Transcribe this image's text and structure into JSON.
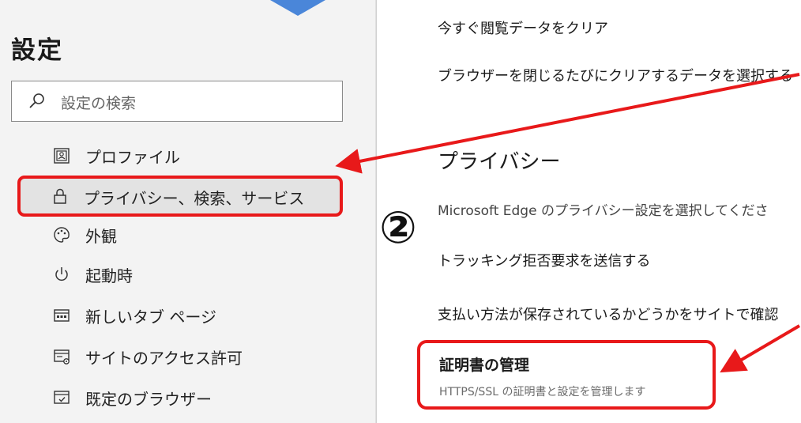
{
  "sidebar": {
    "title": "設定",
    "search": {
      "placeholder": "設定の検索"
    },
    "items": [
      {
        "label": "プロファイル",
        "icon": "profile-icon"
      },
      {
        "label": "プライバシー、検索、サービス",
        "icon": "lock-icon",
        "selected": true
      },
      {
        "label": "外観",
        "icon": "palette-icon"
      },
      {
        "label": "起動時",
        "icon": "power-icon"
      },
      {
        "label": "新しいタブ ページ",
        "icon": "new-tab-icon"
      },
      {
        "label": "サイトのアクセス許可",
        "icon": "site-permissions-icon"
      },
      {
        "label": "既定のブラウザー",
        "icon": "default-browser-icon"
      }
    ]
  },
  "main": {
    "clear_now": "今すぐ閲覧データをクリア",
    "clear_on_close": "ブラウザーを閉じるたびにクリアするデータを選択する",
    "privacy_title": "プライバシー",
    "privacy_desc": "Microsoft Edge のプライバシー設定を選択してくださ",
    "do_not_track": "トラッキング拒否要求を送信する",
    "payment_check": "支払い方法が保存されているかどうかをサイトで確認",
    "certificates": {
      "title": "証明書の管理",
      "subtitle": "HTTPS/SSL の証明書と設定を管理します"
    }
  },
  "annotation": {
    "step_number": "②",
    "highlight_color": "#e8191a",
    "arrow_color": "#e8191a",
    "top_arrow_color": "#4a86d9"
  }
}
